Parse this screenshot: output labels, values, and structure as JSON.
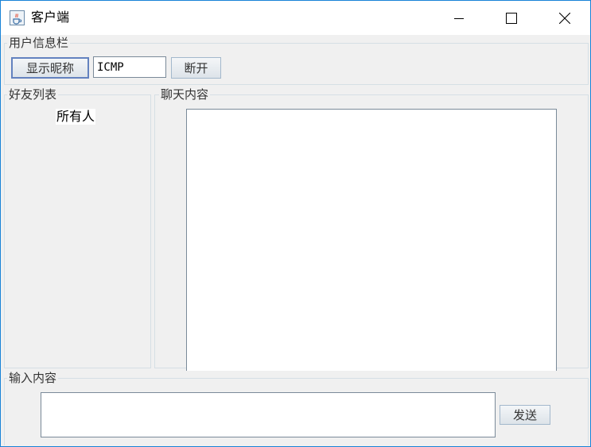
{
  "window": {
    "title": "客户端",
    "icon": "java-cup-icon"
  },
  "user_info": {
    "group_title": "用户信息栏",
    "show_nickname_label": "显示昵称",
    "nickname_value": "ICMP",
    "disconnect_label": "断开"
  },
  "friends": {
    "group_title": "好友列表",
    "items": [
      "所有人"
    ]
  },
  "chat": {
    "group_title": "聊天内容",
    "content": ""
  },
  "input": {
    "group_title": "输入内容",
    "value": "",
    "send_label": "发送"
  },
  "colors": {
    "window_border": "#1883d7",
    "panel_background": "#f0f0f0",
    "button_border": "#a3b8cc"
  }
}
